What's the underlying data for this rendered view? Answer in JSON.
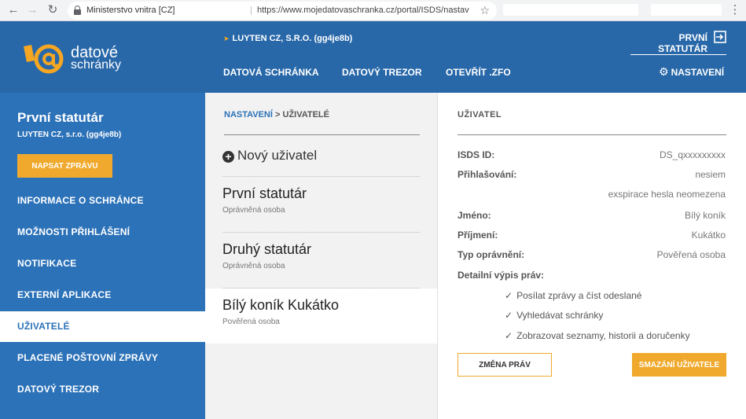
{
  "browser": {
    "site_label": "Ministerstvo vnitra [CZ]",
    "url": "https://www.mojedatovaschranka.cz/portal/ISDS/nastaveni/uzivatele/s..."
  },
  "header": {
    "logo_line1": "datové",
    "logo_line2": "schránky",
    "company": "LUYTEN CZ, S.R.O. (gg4je8b)",
    "user": "PRVNÍ STATUTÁR",
    "nav": [
      "DATOVÁ SCHRÁNKA",
      "DATOVÝ TREZOR",
      "OTEVŘÍT .ZFO"
    ],
    "settings": "NASTAVENÍ"
  },
  "sidebar": {
    "title": "První statutár",
    "subtitle": "LUYTEN CZ, s.r.o. (gg4je8b)",
    "write_button": "NAPSAT ZPRÁVU",
    "items": [
      {
        "label": "INFORMACE O SCHRÁNCE"
      },
      {
        "label": "MOŽNOSTI PŘIHLÁŠENÍ"
      },
      {
        "label": "NOTIFIKACE"
      },
      {
        "label": "EXTERNÍ APLIKACE"
      },
      {
        "label": "UŽIVATELÉ"
      },
      {
        "label": "PLACENÉ POŠTOVNÍ ZPRÁVY"
      },
      {
        "label": "DATOVÝ TREZOR"
      }
    ]
  },
  "users_list": {
    "breadcrumb_parent": "NASTAVENÍ",
    "breadcrumb_sep": ">",
    "breadcrumb_current": "UŽIVATELÉ",
    "new_user": "Nový uživatel",
    "users": [
      {
        "name": "První statutár",
        "role": "Oprávněná osoba"
      },
      {
        "name": "Druhý statutár",
        "role": "Oprávněná osoba"
      },
      {
        "name": "Bílý koník Kukátko",
        "role": "Pověřená osoba"
      }
    ]
  },
  "detail": {
    "heading": "UŽIVATEL",
    "isds_label": "ISDS ID:",
    "isds_value": "DS_qxxxxxxxxx",
    "login_label": "Přihlašování:",
    "login_value": "nesiem",
    "password_note": "exspirace hesla neomezena",
    "first_name_label": "Jméno:",
    "first_name_value": "Bílý koník",
    "last_name_label": "Příjmení:",
    "last_name_value": "Kukátko",
    "permission_label": "Typ oprávnění:",
    "permission_value": "Pověřená osoba",
    "rights_label": "Detailní výpis práv:",
    "rights": [
      "Posílat zprávy a číst odeslané",
      "Vyhledávat schránky",
      "Zobrazovat seznamy, historii a doručenky"
    ],
    "change_button": "ZMĚNA PRÁV",
    "delete_button": "SMAZÁNÍ UŽIVATELE"
  }
}
